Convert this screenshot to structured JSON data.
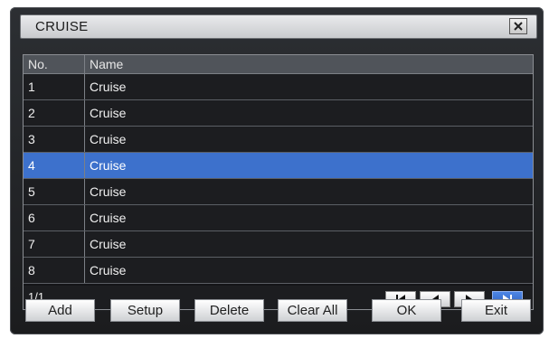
{
  "dialog": {
    "title": "CRUISE",
    "close_icon": "close-x-icon"
  },
  "table": {
    "headers": {
      "no": "No.",
      "name": "Name"
    },
    "rows": [
      {
        "no": "1",
        "name": "Cruise"
      },
      {
        "no": "2",
        "name": "Cruise"
      },
      {
        "no": "3",
        "name": "Cruise"
      },
      {
        "no": "4",
        "name": "Cruise"
      },
      {
        "no": "5",
        "name": "Cruise"
      },
      {
        "no": "6",
        "name": "Cruise"
      },
      {
        "no": "7",
        "name": "Cruise"
      },
      {
        "no": "8",
        "name": "Cruise"
      }
    ],
    "selected_row_no": "4",
    "selected_color": "#3d71cc"
  },
  "pagination": {
    "page": "1/1",
    "icons": [
      "first-page-icon",
      "previous-page-icon",
      "next-page-icon",
      "last-page-icon"
    ]
  },
  "buttons": {
    "add": "Add",
    "setup": "Setup",
    "delete": "Delete",
    "clear_all": "Clear All",
    "ok": "OK",
    "exit": "Exit"
  }
}
